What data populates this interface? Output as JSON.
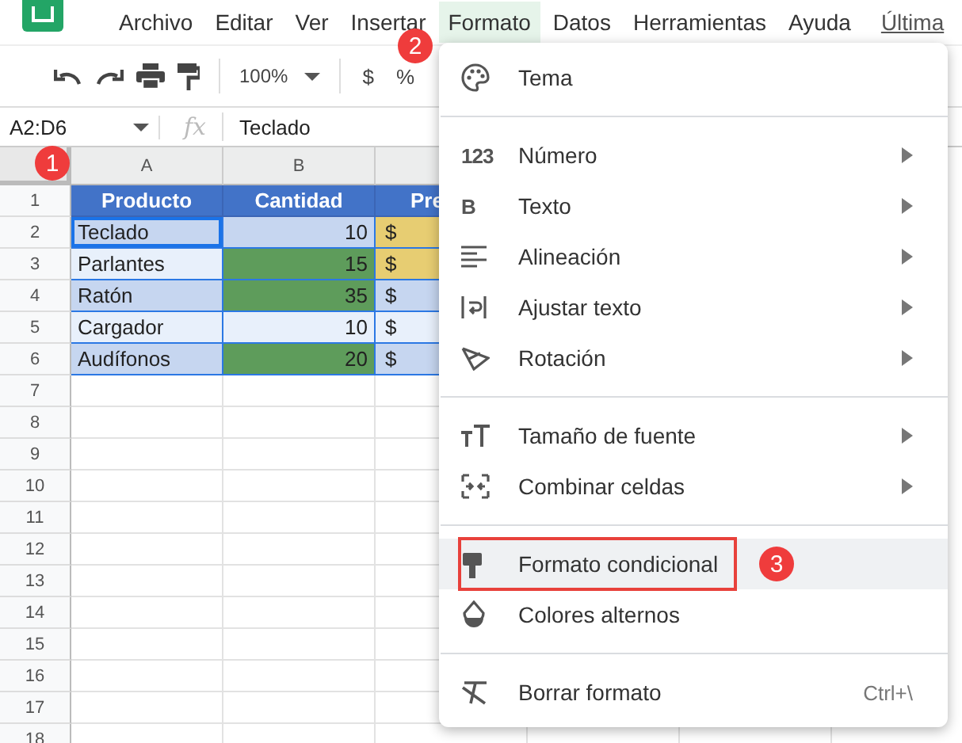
{
  "menu_bar": [
    {
      "label": "Archivo",
      "selected": false
    },
    {
      "label": "Editar",
      "selected": false
    },
    {
      "label": "Ver",
      "selected": false
    },
    {
      "label": "Insertar",
      "selected": false
    },
    {
      "label": "Formato",
      "selected": true
    },
    {
      "label": "Datos",
      "selected": false
    },
    {
      "label": "Herramientas",
      "selected": false
    },
    {
      "label": "Ayuda",
      "selected": false
    }
  ],
  "last_edit_link": "Última",
  "toolbar": {
    "zoom": "100%",
    "currency": "$",
    "percent": "%"
  },
  "formula_bar": {
    "name_box": "A2:D6",
    "fx": "fx",
    "value": "Teclado"
  },
  "sheet": {
    "columns": [
      "A",
      "B"
    ],
    "row_numbers": [
      "1",
      "2",
      "3",
      "4",
      "5",
      "6",
      "7",
      "8",
      "9",
      "10",
      "11",
      "12",
      "13",
      "14",
      "15",
      "16",
      "17",
      "18"
    ],
    "rows": [
      {
        "kind": "header",
        "cells": [
          {
            "text": "Producto",
            "color": "#4273c8"
          },
          {
            "text": "Cantidad",
            "color": "#4273c8"
          },
          {
            "text": "Pre",
            "color": "#4273c8"
          }
        ]
      },
      {
        "kind": "data",
        "cells": [
          {
            "text": "Teclado",
            "color": "#c6d6f0"
          },
          {
            "text": "10",
            "color": "#c6d6f0"
          },
          {
            "text": "$",
            "color": "#e7cd72"
          }
        ]
      },
      {
        "kind": "data",
        "cells": [
          {
            "text": "Parlantes",
            "color": "#e8f0fb"
          },
          {
            "text": "15",
            "color": "#5e9c5b"
          },
          {
            "text": "$",
            "color": "#e7cd72"
          }
        ]
      },
      {
        "kind": "data",
        "cells": [
          {
            "text": "Ratón",
            "color": "#c6d6f0"
          },
          {
            "text": "35",
            "color": "#5e9c5b"
          },
          {
            "text": "$",
            "color": "#c6d6f0"
          }
        ]
      },
      {
        "kind": "data",
        "cells": [
          {
            "text": "Cargador",
            "color": "#e8f0fb"
          },
          {
            "text": "10",
            "color": "#e8f0fb"
          },
          {
            "text": "$",
            "color": "#e8f0fb"
          }
        ]
      },
      {
        "kind": "data",
        "cells": [
          {
            "text": "Audífonos",
            "color": "#c6d6f0"
          },
          {
            "text": "20",
            "color": "#5e9c5b"
          },
          {
            "text": "$",
            "color": "#c6d6f0"
          }
        ]
      }
    ]
  },
  "format_menu": [
    {
      "kind": "item",
      "label": "Tema",
      "submenu": false,
      "selected": false
    },
    {
      "kind": "divider"
    },
    {
      "kind": "item",
      "glyph": "123",
      "label": "Número",
      "submenu": true,
      "selected": false
    },
    {
      "kind": "item",
      "glyph": "B",
      "label": "Texto",
      "submenu": true,
      "selected": false
    },
    {
      "kind": "item",
      "label": "Alineación",
      "submenu": true,
      "selected": false
    },
    {
      "kind": "item",
      "label": "Ajustar texto",
      "submenu": true,
      "selected": false
    },
    {
      "kind": "item",
      "label": "Rotación",
      "submenu": true,
      "selected": false
    },
    {
      "kind": "divider"
    },
    {
      "kind": "item",
      "label": "Tamaño de fuente",
      "submenu": true,
      "selected": false
    },
    {
      "kind": "item",
      "label": "Combinar celdas",
      "submenu": true,
      "selected": false
    },
    {
      "kind": "divider"
    },
    {
      "kind": "item",
      "label": "Formato condicional",
      "submenu": false,
      "selected": true,
      "badge": "3"
    },
    {
      "kind": "item",
      "label": "Colores alternos",
      "submenu": false,
      "selected": false
    },
    {
      "kind": "divider"
    },
    {
      "kind": "item",
      "label": "Borrar formato",
      "submenu": false,
      "selected": false,
      "shortcut": "Ctrl+\\"
    }
  ],
  "step_badges": [
    "1",
    "2"
  ]
}
